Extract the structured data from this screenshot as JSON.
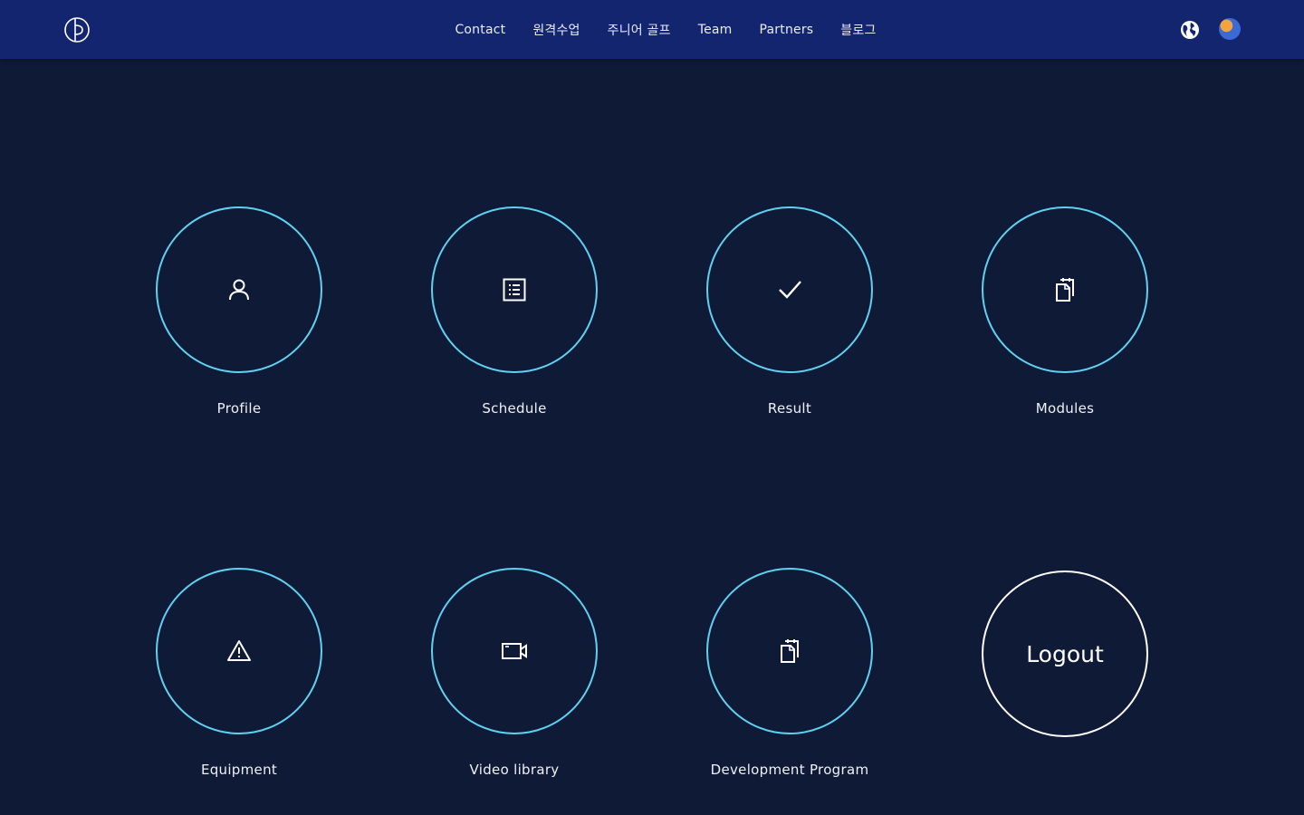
{
  "header": {
    "logo_icon": "brand-logo-icon",
    "nav": [
      {
        "label": "Contact"
      },
      {
        "label": "원격수업"
      },
      {
        "label": "주니어 골프"
      },
      {
        "label": "Team"
      },
      {
        "label": "Partners"
      },
      {
        "label": "블로그"
      }
    ],
    "language_icon": "globe-icon",
    "avatar_icon": "user-avatar"
  },
  "colors": {
    "background": "#0f1a36",
    "header": "#13256f",
    "accent": "#5fd2f3",
    "logout_border": "#ffffff"
  },
  "tiles": [
    {
      "label": "Profile",
      "icon": "user-icon"
    },
    {
      "label": "Schedule",
      "icon": "list-icon"
    },
    {
      "label": "Result",
      "icon": "check-icon"
    },
    {
      "label": "Modules",
      "icon": "documents-icon"
    },
    {
      "label": "Equipment",
      "icon": "warning-icon"
    },
    {
      "label": "Video library",
      "icon": "video-icon"
    },
    {
      "label": "Development Program",
      "icon": "documents-icon"
    }
  ],
  "logout": {
    "label": "Logout"
  }
}
